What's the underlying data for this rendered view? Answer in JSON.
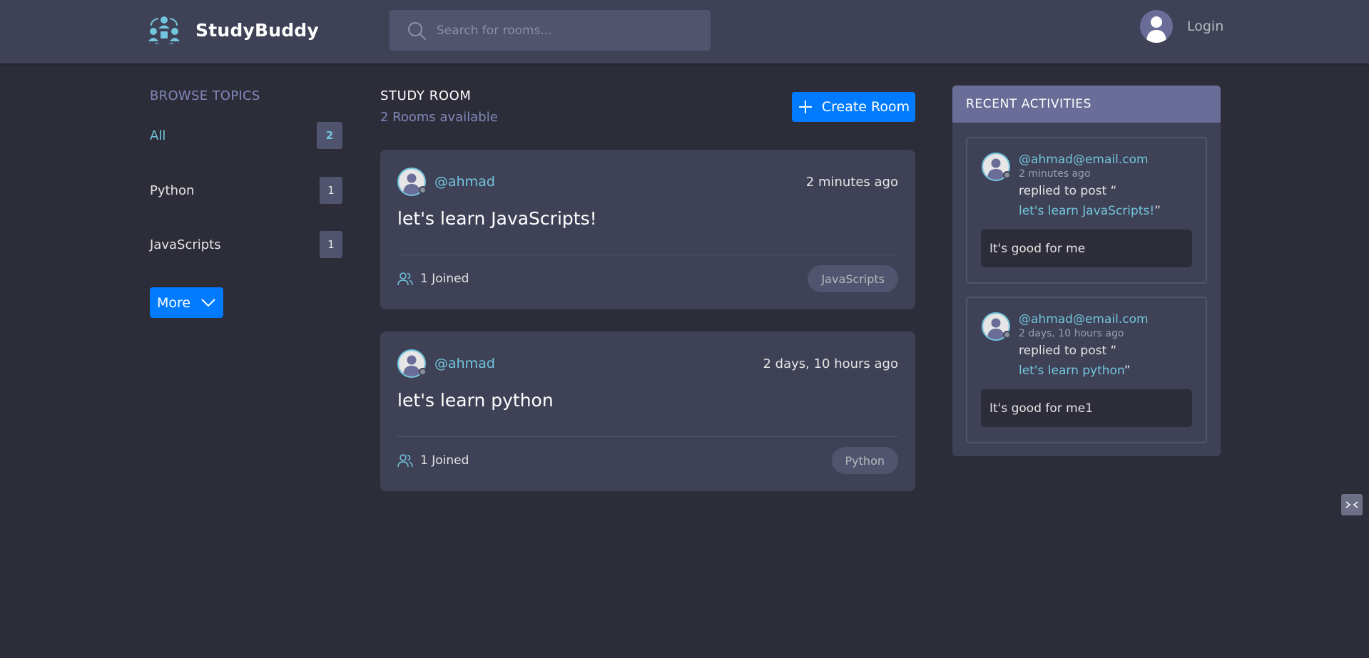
{
  "header": {
    "brand": "StudyBuddy",
    "search_placeholder": "Search for rooms...",
    "login_label": "Login"
  },
  "sidebar": {
    "title": "BROWSE TOPICS",
    "topics": [
      {
        "label": "All",
        "count": "2",
        "active": true
      },
      {
        "label": "Python",
        "count": "1",
        "active": false
      },
      {
        "label": "JavaScripts",
        "count": "1",
        "active": false
      }
    ],
    "more_label": "More"
  },
  "main": {
    "title": "STUDY ROOM",
    "rooms_available": "2 Rooms available",
    "create_label": "Create Room",
    "rooms": [
      {
        "host": "@ahmad",
        "time": "2 minutes ago",
        "name": "let's learn JavaScripts!",
        "joined": "1 Joined",
        "topic": "JavaScripts"
      },
      {
        "host": "@ahmad",
        "time": "2 days, 10 hours ago",
        "name": "let's learn python",
        "joined": "1 Joined",
        "topic": "Python"
      }
    ]
  },
  "activities": {
    "title": "RECENT ACTIVITIES",
    "items": [
      {
        "user": "@ahmad@email.com",
        "time": "2 minutes ago",
        "replied": "replied to post “",
        "post": "let's learn JavaScripts!",
        "close_quote": "”",
        "message": "It's good for me"
      },
      {
        "user": "@ahmad@email.com",
        "time": "2 days, 10 hours ago",
        "replied": "replied to post “",
        "post": "let's learn python",
        "close_quote": "”",
        "message": "It's good for me1"
      }
    ]
  },
  "colors": {
    "background": "#2d2d39",
    "panel": "#3f4156",
    "accent_blue": "#007bff",
    "accent_cyan": "#71c6dd",
    "muted_purple": "#8188ba"
  }
}
